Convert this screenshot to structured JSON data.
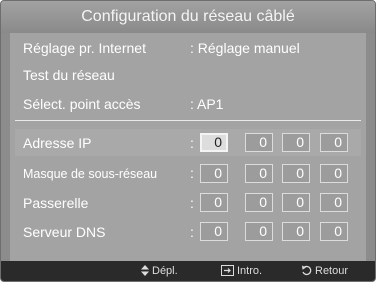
{
  "title": "Configuration du réseau câblé",
  "rows": {
    "internet_setting": {
      "label": "Réglage pr. Internet",
      "value": ": Réglage manuel"
    },
    "network_test": {
      "label": "Test du réseau"
    },
    "access_point": {
      "label": "Sélect. point accès",
      "value": ": AP1"
    }
  },
  "ip_fields": [
    {
      "label": "Adresse IP",
      "octets": [
        "0",
        "0",
        "0",
        "0"
      ]
    },
    {
      "label": "Masque de sous-réseau",
      "octets": [
        "0",
        "0",
        "0",
        "0"
      ]
    },
    {
      "label": "Passerelle",
      "octets": [
        "0",
        "0",
        "0",
        "0"
      ]
    },
    {
      "label": "Serveur DNS",
      "octets": [
        "0",
        "0",
        "0",
        "0"
      ]
    }
  ],
  "colon": ":",
  "footer": {
    "move": "Dépl.",
    "enter": "Intro.",
    "return": "Retour"
  },
  "icons": {
    "move": "updown-arrows-icon",
    "enter": "enter-icon",
    "return": "return-icon"
  },
  "colors": {
    "panel": "#a3a3a3",
    "frame": "#8c8c8c",
    "footer": "#2a2a2a",
    "active_octet": "#dddddd"
  }
}
